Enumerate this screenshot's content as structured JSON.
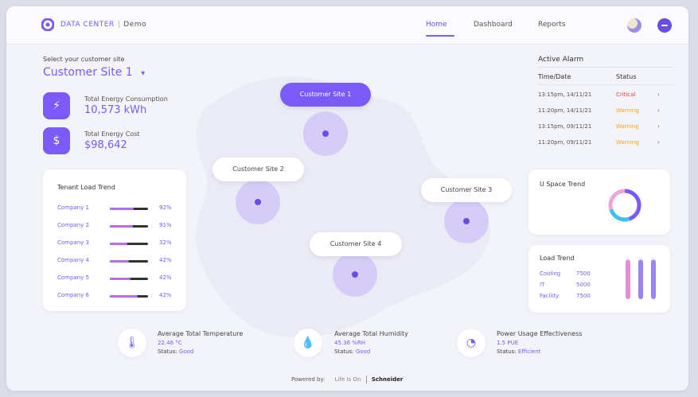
{
  "header": {
    "brand": "DATA CENTER",
    "separator": "|",
    "app_sub": "Demo",
    "nav": [
      {
        "label": "Home",
        "active": true
      },
      {
        "label": "Dashboard",
        "active": false
      },
      {
        "label": "Reports",
        "active": false
      }
    ]
  },
  "site": {
    "prompt": "Select your customer site",
    "selected": "Customer Site 1",
    "chevron": "▾"
  },
  "kpis": [
    {
      "icon": "energy-plug-icon",
      "glyph": "⚡",
      "title": "Total Energy Consumption",
      "value": "10,573 kWh"
    },
    {
      "icon": "dollar-icon",
      "glyph": "$",
      "title": "Total Energy Cost",
      "value": "$98,642"
    }
  ],
  "tenant_trend": {
    "title": "Tenant Load Trend",
    "rows": [
      {
        "name": "Company 1",
        "pct": "92%",
        "fill": 0.62
      },
      {
        "name": "Company 2",
        "pct": "91%",
        "fill": 0.6
      },
      {
        "name": "Company 3",
        "pct": "32%",
        "fill": 0.45
      },
      {
        "name": "Company 4",
        "pct": "42%",
        "fill": 0.5
      },
      {
        "name": "Company 5",
        "pct": "42%",
        "fill": 0.55
      },
      {
        "name": "Company 6",
        "pct": "42%",
        "fill": 0.72
      }
    ]
  },
  "sites": [
    {
      "label": "Customer Site 1",
      "active": true
    },
    {
      "label": "Customer Site 2",
      "active": false
    },
    {
      "label": "Customer Site 3",
      "active": false
    },
    {
      "label": "Customer Site 4",
      "active": false
    }
  ],
  "alarms": {
    "title": "Active Alarm",
    "col_time": "Time/Date",
    "col_status": "Status",
    "rows": [
      {
        "time": "13:15pm, 14/11/21",
        "status": "Critical",
        "color": "#e23d3d"
      },
      {
        "time": "11:20pm, 14/11/21",
        "status": "Warning",
        "color": "#f5a623"
      },
      {
        "time": "13:15pm, 09/11/21",
        "status": "Warning",
        "color": "#f5a623"
      },
      {
        "time": "11:20pm, 09/11/21",
        "status": "Warning",
        "color": "#f5a623"
      }
    ]
  },
  "uspace": {
    "title": "U Space Trend",
    "segments": [
      {
        "value": 0.45,
        "color": "#7a5af8"
      },
      {
        "value": 0.25,
        "color": "#3dc2f0"
      },
      {
        "value": 0.3,
        "color": "#f0a5d8"
      }
    ]
  },
  "load_trend": {
    "title": "Load Trend",
    "rows": [
      {
        "name": "Cooling",
        "value": "7500"
      },
      {
        "name": "IT",
        "value": "5000"
      },
      {
        "name": "Facility",
        "value": "7500"
      }
    ],
    "bars": [
      0.95,
      0.95,
      0.95
    ]
  },
  "bottom": [
    {
      "icon": "thermometer-icon",
      "glyph": "🌡",
      "title": "Average Total Temperature",
      "sub": "22.46 °C",
      "status_label": "Status:",
      "status": "Good"
    },
    {
      "icon": "humidity-drop-icon",
      "glyph": "💧",
      "title": "Average Total Humidity",
      "sub": "45.36 %RH",
      "status_label": "Status:",
      "status": "Good"
    },
    {
      "icon": "gauge-icon",
      "glyph": "◔",
      "title": "Power Usage Effectiveness",
      "sub": "1.5 PUE",
      "status_label": "Status:",
      "status": "Efficient"
    }
  ],
  "footer": {
    "powered": "Powered by:",
    "partner": "Life Is On",
    "vendor": "Schneider"
  },
  "colors": {
    "accent": "#7a5af8",
    "critical": "#e23d3d",
    "warning": "#f5a623"
  }
}
